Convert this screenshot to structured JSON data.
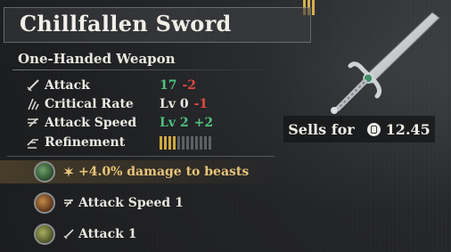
{
  "item": {
    "name": "Chillfallen Sword",
    "type": "One-Handed Weapon",
    "tier_level": 3
  },
  "stats": [
    {
      "label": "Attack",
      "icon": "attack-icon",
      "value": "17",
      "delta": "-2",
      "delta_color": "#e04a40"
    },
    {
      "label": "Critical Rate",
      "icon": "critical-rate-icon",
      "value": "Lv 0",
      "delta": "-1",
      "delta_color": "#e04a40"
    },
    {
      "label": "Attack Speed",
      "icon": "attack-speed-icon",
      "value": "Lv 2",
      "delta": "+2",
      "delta_color": "#4fc27c"
    },
    {
      "label": "Refinement",
      "icon": "refinement-icon",
      "filled": 4,
      "total": 12
    }
  ],
  "sell": {
    "label": "Sells for",
    "icon": "coin-icon",
    "price": "12.45"
  },
  "perks": [
    {
      "text": "+4.0% damage to beasts",
      "gem": "green-gem-icon",
      "icon": "burst-icon",
      "highlight": true
    },
    {
      "text": "Attack Speed 1",
      "gem": "orange-gem-icon",
      "icon": "attack-speed-icon",
      "highlight": false
    },
    {
      "text": "Attack 1",
      "gem": "olive-gem-icon",
      "icon": "attack-icon",
      "highlight": false
    }
  ],
  "colors": {
    "gold": "#cfa942",
    "positive": "#4fc27c",
    "negative": "#e04a40",
    "perk_highlight": "#e9c57a"
  }
}
